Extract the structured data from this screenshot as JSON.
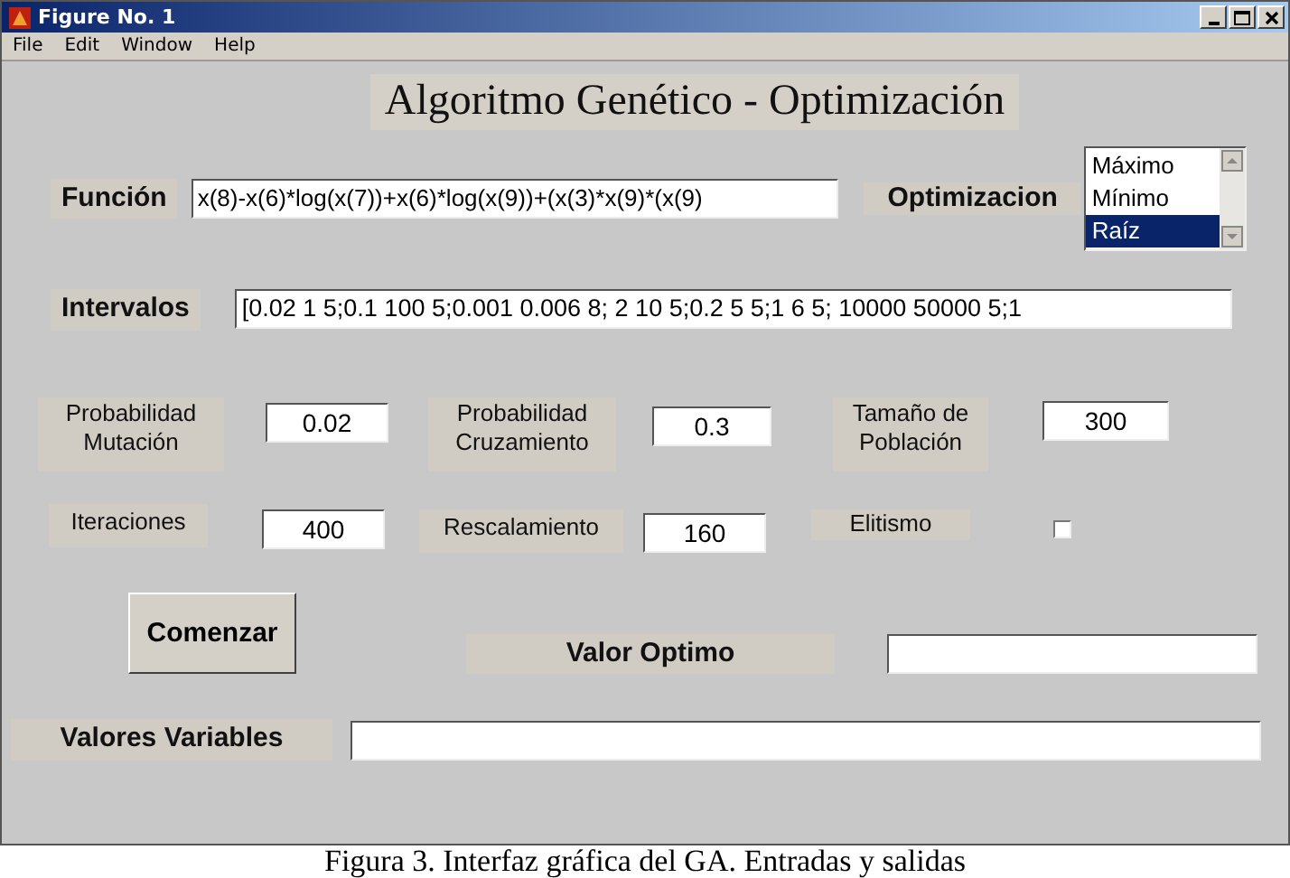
{
  "window": {
    "title": "Figure No. 1"
  },
  "menu": [
    "File",
    "Edit",
    "Window",
    "Help"
  ],
  "heading": "Algoritmo Genético - Optimización",
  "funcion": {
    "label": "Función",
    "value": "x(8)-x(6)*log(x(7))+x(6)*log(x(9))+(x(3)*x(9)*(x(9)"
  },
  "optimizacion": {
    "label": "Optimizacion",
    "options": [
      {
        "label": "Máximo",
        "selected": false
      },
      {
        "label": "Mínimo",
        "selected": false
      },
      {
        "label": "Raíz",
        "selected": true
      }
    ]
  },
  "intervalos": {
    "label": "Intervalos",
    "value": "[0.02 1 5;0.1 100 5;0.001 0.006 8; 2 10 5;0.2 5 5;1 6 5; 10000 50000 5;1"
  },
  "params_row_1": [
    {
      "label": "Probabilidad Mutación",
      "value": "0.02"
    },
    {
      "label": "Probabilidad Cruzamiento",
      "value": "0.3"
    },
    {
      "label": "Tamaño de Población",
      "value": "300"
    }
  ],
  "params_row_2": [
    {
      "label": "Iteraciones",
      "value": "400"
    },
    {
      "label": "Rescalamiento",
      "value": "160"
    }
  ],
  "elitismo": {
    "label": "Elitismo",
    "checked": false
  },
  "start_button": "Comenzar",
  "valor_optimo": {
    "label": "Valor Optimo"
  },
  "valores_variables": {
    "label": "Valores Variables"
  },
  "caption": "Figura 3. Interfaz gráfica del GA. Entradas y salidas"
}
